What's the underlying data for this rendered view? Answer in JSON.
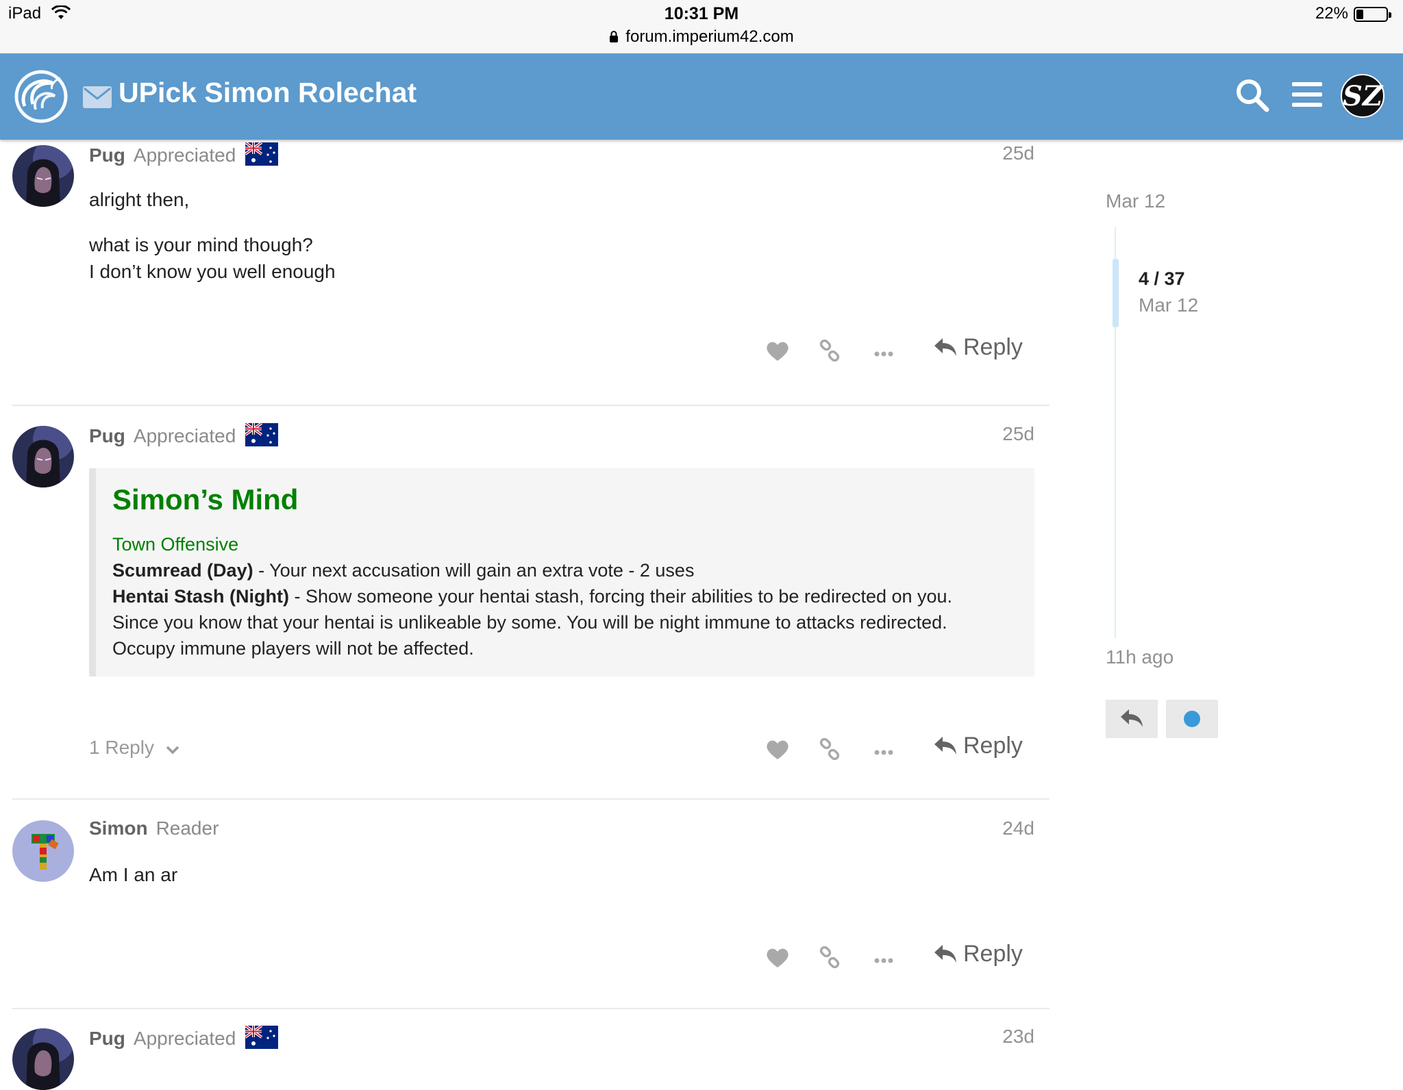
{
  "status_bar": {
    "device": "iPad",
    "time": "10:31 PM",
    "url": "forum.imperium42.com",
    "battery": "22%"
  },
  "header": {
    "title": "UPick Simon Rolechat",
    "avatar_initials": "SZ"
  },
  "posts": [
    {
      "username": "Pug",
      "user_title": "Appreciated",
      "age": "25d",
      "body": [
        "alright then,",
        "what is your mind though?",
        "I don’t know you well enough"
      ],
      "reply_label": "Reply"
    },
    {
      "username": "Pug",
      "user_title": "Appreciated",
      "age": "25d",
      "quote": {
        "title": "Simon’s Mind",
        "subtitle": "Town Offensive",
        "ability1_name": "Scumread (Day)",
        "ability1_text": " - Your next accusation will gain an extra vote - 2 uses",
        "ability2_name": "Hentai Stash (Night)",
        "ability2_text": " - Show someone your hentai stash, forcing their abilities to be redirected on you.",
        "line3": "Since you know that your hentai is unlikeable by some. You will be night immune to attacks redirected.",
        "line4": "Occupy immune players will not be affected."
      },
      "replies_count": "1 Reply",
      "reply_label": "Reply"
    },
    {
      "username": "Simon",
      "user_title": "Reader",
      "age": "24d",
      "body": [
        "Am I an ar"
      ],
      "reply_label": "Reply"
    },
    {
      "username": "Pug",
      "user_title": "Appreciated",
      "age": "23d"
    }
  ],
  "timeline": {
    "top_date": "Mar 12",
    "position": "4 / 37",
    "position_date": "Mar 12",
    "bottom_label": "11h ago"
  },
  "colors": {
    "header_bg": "#5d9acd",
    "quote_green": "#008000",
    "notification_dot": "#3a9ad9"
  }
}
